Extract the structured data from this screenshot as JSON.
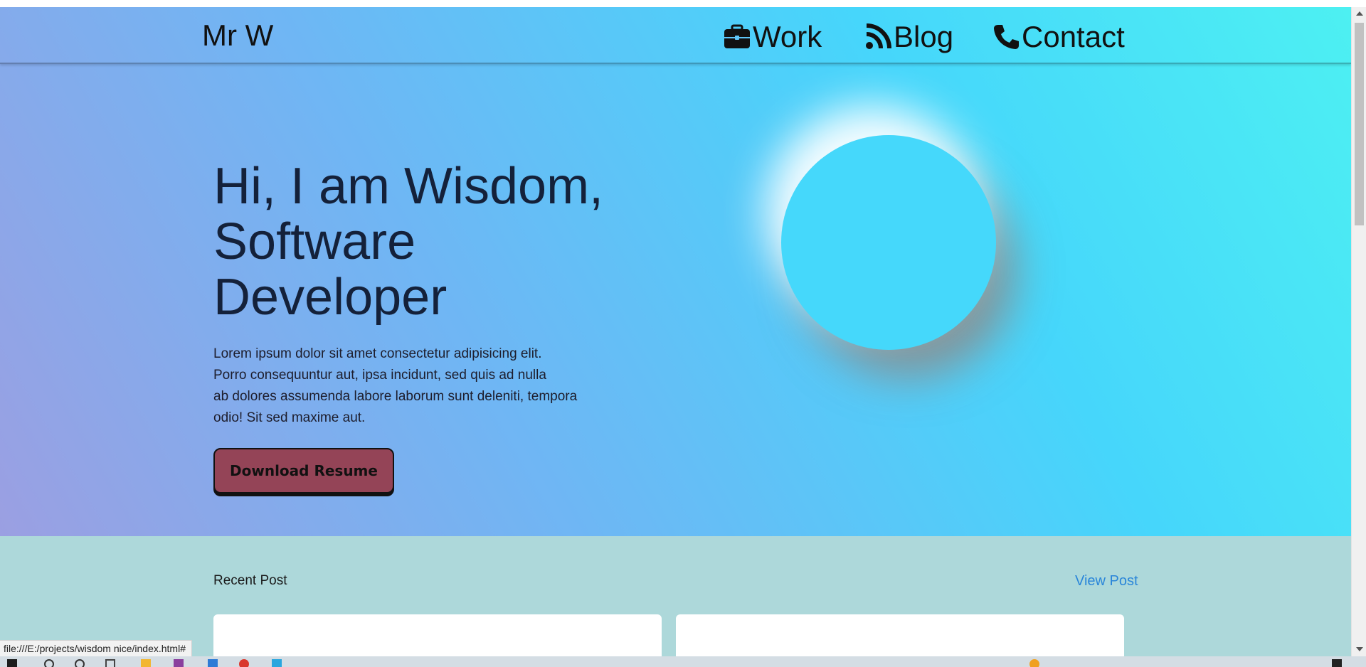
{
  "nav": {
    "brand": "Mr W",
    "links": [
      {
        "label": "Work",
        "icon": "briefcase-icon"
      },
      {
        "label": "Blog",
        "icon": "rss-icon"
      },
      {
        "label": "Contact",
        "icon": "phone-icon"
      }
    ]
  },
  "hero": {
    "headline_line1": "Hi, I am Wisdom,",
    "headline_line2": "Software",
    "headline_line3": "Developer",
    "intro_line1": "Lorem ipsum dolor sit amet consectetur adipisicing elit.",
    "intro_line2": "Porro consequuntur aut, ipsa incidunt, sed quis ad nulla",
    "intro_line3": "ab dolores assumenda labore laborum sunt deleniti, tempora",
    "intro_line4": "odio! Sit sed maxime aut.",
    "button_label": "Download Resume"
  },
  "posts": {
    "title": "Recent Post",
    "view_link": "View Post"
  },
  "status_bar": {
    "url": "file:///E:/projects/wisdom nice/index.html#"
  },
  "colors": {
    "hero_gradient_start": "#9b9fe2",
    "hero_gradient_end": "#4df0f2",
    "button_bg": "#944457",
    "posts_bg": "#add8da",
    "link": "#2a86d9"
  }
}
